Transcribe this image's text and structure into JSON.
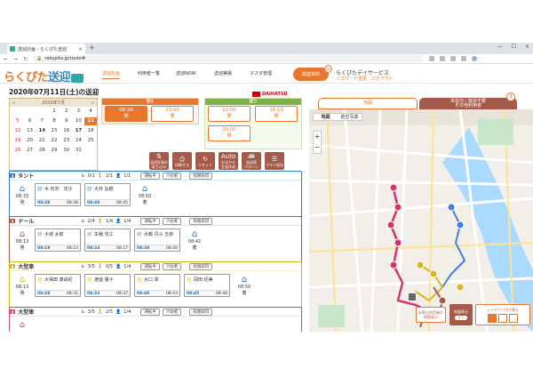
{
  "browser": {
    "tab_title": "送迎計画 - らくぴた送迎",
    "url": "rakupita.jp/route#",
    "new_tab": "+",
    "close": "×",
    "window_controls": [
      "—",
      "☐",
      "×"
    ]
  },
  "app": {
    "logo_main": "らくぴた",
    "logo_sub": "送迎",
    "nav": [
      "送迎計画",
      "利用者一覧",
      "送迎NOW",
      "送迎実績",
      "マスタ管理"
    ],
    "facility_button": "関連資料",
    "facility_badge": "10",
    "facility_name": "らくぴたデイサービス",
    "facility_links": "パスワード変更　ログアウト"
  },
  "day_title": "2020年07月11日(土)の送迎",
  "calendar": {
    "prev": "«",
    "month": "2020年7月",
    "next": "»",
    "weeks": [
      [
        "",
        "",
        "",
        "1",
        "2",
        "3",
        "4"
      ],
      [
        "5",
        "6",
        "7",
        "8",
        "9",
        "10",
        "11"
      ],
      [
        "12",
        "13",
        "14",
        "15",
        "16",
        "17",
        "18"
      ],
      [
        "19",
        "20",
        "21",
        "22",
        "23",
        "24",
        "25"
      ],
      [
        "26",
        "27",
        "28",
        "29",
        "30",
        "31",
        ""
      ],
      [
        "",
        "",
        "",
        "",
        "",
        "",
        ""
      ]
    ],
    "selected": "11",
    "bold_days": [
      "14",
      "17"
    ]
  },
  "pickup": {
    "header": "迎え",
    "slots": [
      {
        "time": "08:38",
        "label": "発",
        "selected": true
      },
      {
        "time": "13:00",
        "label": "発",
        "selected": false
      }
    ]
  },
  "dropoff": {
    "header": "送り",
    "slots": [
      {
        "time": "12:00",
        "label": "発"
      },
      {
        "time": "16:10",
        "label": "発"
      },
      {
        "time": "20:00",
        "label": "発"
      }
    ],
    "brand": "DAIHATSU"
  },
  "actions": [
    {
      "icon": "⇅",
      "label": "送迎計画の\n取り込み"
    },
    {
      "icon": "⎙",
      "label": "印刷する"
    },
    {
      "icon": "↻",
      "label": "リセット"
    },
    {
      "icon": "Auto",
      "label": "おまかせ\n計画作成"
    },
    {
      "icon": "🚐",
      "label": "送迎表\nパターン"
    },
    {
      "icon": "☰",
      "label": "プラン保存"
    }
  ],
  "vehicles": [
    {
      "name": "タント",
      "color": "#2a78c8",
      "counts": [
        "0/1",
        "2/1",
        "1/1"
      ],
      "driver": "運転手",
      "helper": "介助者",
      "route_btn": "経路取得",
      "start": {
        "time": "08:33",
        "label": "発"
      },
      "end": {
        "time": "08:50",
        "label": "着"
      },
      "passengers": [
        {
          "type": "迎",
          "name": "木 石井　花子",
          "t1": "08:38",
          "t2": "08:38"
        },
        {
          "type": "迎",
          "name": "大井 弘樹",
          "t1": "08:40",
          "t2": "08:45"
        }
      ]
    },
    {
      "name": "ドール",
      "color": "#a65a4a",
      "counts": [
        "2/4",
        "1/4",
        "1/4"
      ],
      "driver": "運転手",
      "helper": "介助者",
      "route_btn": "経路取得",
      "start": {
        "time": "08:13",
        "label": "発"
      },
      "end": {
        "time": "08:42",
        "label": "着"
      },
      "passengers": [
        {
          "type": "迎",
          "name": "大城 太郎",
          "t1": "08:18",
          "t2": "08:23"
        },
        {
          "type": "迎",
          "name": "矢幡 花江",
          "t1": "08:24",
          "t2": "08:27"
        },
        {
          "type": "迎",
          "name": "水鏡 丹斗 五郎",
          "t1": "08:30",
          "t2": "08:40"
        }
      ]
    },
    {
      "name": "大型車",
      "color": "#d9b51e",
      "counts": [
        "3/5",
        "0/5",
        "1/4"
      ],
      "driver": "運転手",
      "helper": "介助者",
      "route_btn": "経路取得",
      "start": {
        "time": "08:13",
        "label": "発"
      },
      "end": {
        "time": "08:50",
        "label": "着"
      },
      "passengers": [
        {
          "type": "迎",
          "name": "大保田 康由紀",
          "t1": "08:28",
          "t2": "08:31"
        },
        {
          "type": "迎",
          "name": "渡邊 優子",
          "t1": "08:32",
          "t2": "08:37"
        },
        {
          "type": "迎",
          "name": "水口 翠",
          "t1": "08:40",
          "t2": "08:43"
        },
        {
          "type": "迎",
          "name": "岡田 紀美",
          "t1": "08:45",
          "t2": "08:48"
        }
      ]
    },
    {
      "name": "大型車",
      "color": "#c64d78",
      "counts": [
        "3/5",
        "2/5",
        "1/4"
      ],
      "driver": "運転手",
      "helper": "介助者",
      "route_btn": "経路取得",
      "start": {
        "time": "",
        "label": ""
      },
      "end": {
        "time": "",
        "label": ""
      },
      "passengers": []
    }
  ],
  "map": {
    "tab_map": "地図",
    "tab_other": "未割当 / 後追不要\nその他利用者",
    "badge": "3",
    "type_map": "地図",
    "type_sat": "航空写真",
    "zoom_in": "+",
    "zoom_out": "−",
    "btn_show": "未割当利用者の\n地図表示",
    "btn_display": "地図表示",
    "btn_toggle": "オン",
    "btn_layout": "レイアウト切り替え"
  }
}
